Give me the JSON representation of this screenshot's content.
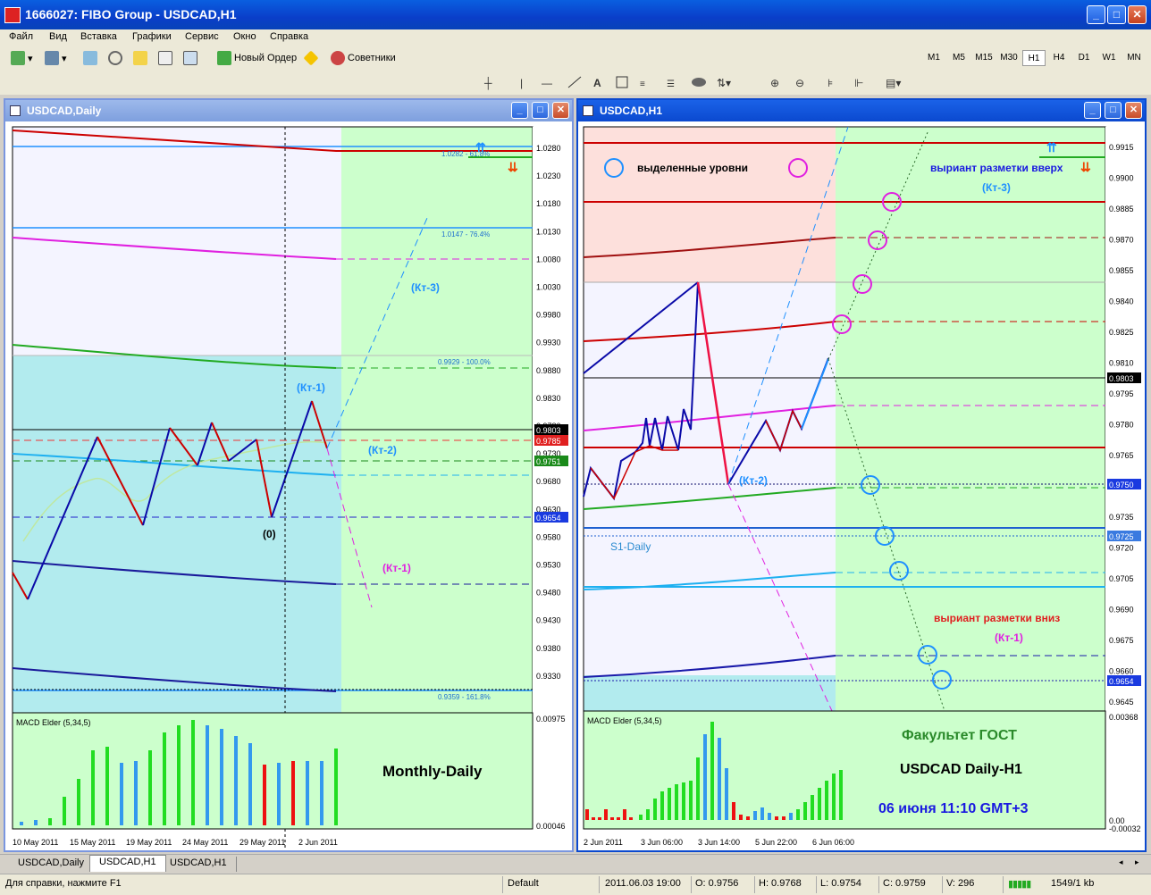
{
  "app": {
    "title": "1666027: FIBO Group - USDCAD,H1",
    "icon_label": "FIBO"
  },
  "menu": [
    "Файл",
    "Вид",
    "Вставка",
    "Графики",
    "Сервис",
    "Окно",
    "Справка"
  ],
  "toolbar": {
    "new_order_label": "Новый Ордер",
    "advisors_label": "Советники",
    "timeframes": [
      "M1",
      "M5",
      "M15",
      "M30",
      "H1",
      "H4",
      "D1",
      "W1",
      "MN"
    ],
    "selected_timeframe": "H1"
  },
  "left_window": {
    "title": "USDCAD,Daily",
    "price_labels": [
      "1.0280",
      "1.0230",
      "1.0180",
      "1.0130",
      "1.0080",
      "1.0030",
      "0.9980",
      "0.9930",
      "0.9880",
      "0.9830",
      "0.9780",
      "0.9730",
      "0.9680",
      "0.9630",
      "0.9580",
      "0.9530",
      "0.9480",
      "0.9430",
      "0.9380",
      "0.9330"
    ],
    "price_tags": {
      "black": "0.9803",
      "red": "0.9785",
      "green": "0.9751",
      "blue": "0.9654"
    },
    "fib_levels": [
      "1.0282 - 61.8%",
      "1.0147 - 76.4%",
      "0.9929 - 100.0%",
      "0.9359 - 161.8%"
    ],
    "annotations": {
      "kt3": "(Кт-3)",
      "kt1_top": "(Кт-1)",
      "kt2": "(Кт-2)",
      "kt1_bottom": "(Кт-1)",
      "zero": "(0)"
    },
    "indicator_title": "MACD Elder (5,34,5)",
    "indicator_scale": [
      "0.00975",
      "0.00046"
    ],
    "indicator_caption": "Monthly-Daily",
    "dates": [
      "10 May 2011",
      "15 May 2011",
      "19 May 2011",
      "24 May 2011",
      "29 May 2011",
      "2 Jun 2011"
    ]
  },
  "right_window": {
    "title": "USDCAD,H1",
    "price_labels": [
      "0.9915",
      "0.9900",
      "0.9885",
      "0.9870",
      "0.9855",
      "0.9840",
      "0.9825",
      "0.9810",
      "0.9795",
      "0.9780",
      "0.9765",
      "0.9750",
      "0.9735",
      "0.9720",
      "0.9705",
      "0.9690",
      "0.9675",
      "0.9660",
      "0.9645"
    ],
    "price_tags": {
      "black": "0.9803",
      "blue1": "0.9750",
      "blue2": "0.9725",
      "blue3": "0.9654"
    },
    "legend_text": "выделенные уровни",
    "up_variant": "выриант разметки вверх",
    "down_variant": "выриант разметки вниз",
    "annotations": {
      "kt3": "(Кт-3)",
      "kt2": "(Кт-2)",
      "kt1": "(Кт-1)",
      "s1": "S1-Daily"
    },
    "indicator_title": "MACD Elder (5,34,5)",
    "indicator_scale": [
      "0.00368",
      "0.00",
      "-0.00032"
    ],
    "caption_line1": "Факультет ГОСТ",
    "caption_line2": "USDCAD Daily-H1",
    "caption_line3": "06 июня 11:10 GMT+3",
    "dates": [
      "2 Jun 2011",
      "3 Jun 06:00",
      "3 Jun 14:00",
      "5 Jun 22:00",
      "6 Jun 06:00"
    ]
  },
  "tabs": [
    "USDCAD,Daily",
    "USDCAD,H1",
    "USDCAD,H1"
  ],
  "active_tab": 1,
  "status": {
    "help": "Для справки, нажмите F1",
    "profile": "Default",
    "datetime": "2011.06.03 19:00",
    "open": "O: 0.9756",
    "high": "H: 0.9768",
    "low": "L: 0.9754",
    "close": "C: 0.9759",
    "volume": "V: 296",
    "traffic": "1549/1 kb"
  },
  "colors": {
    "green_zone": "#ccffcc",
    "pink_zone": "#fde0dc",
    "cyan_zone": "#b2ebee",
    "accent": "#0a3ec9"
  }
}
